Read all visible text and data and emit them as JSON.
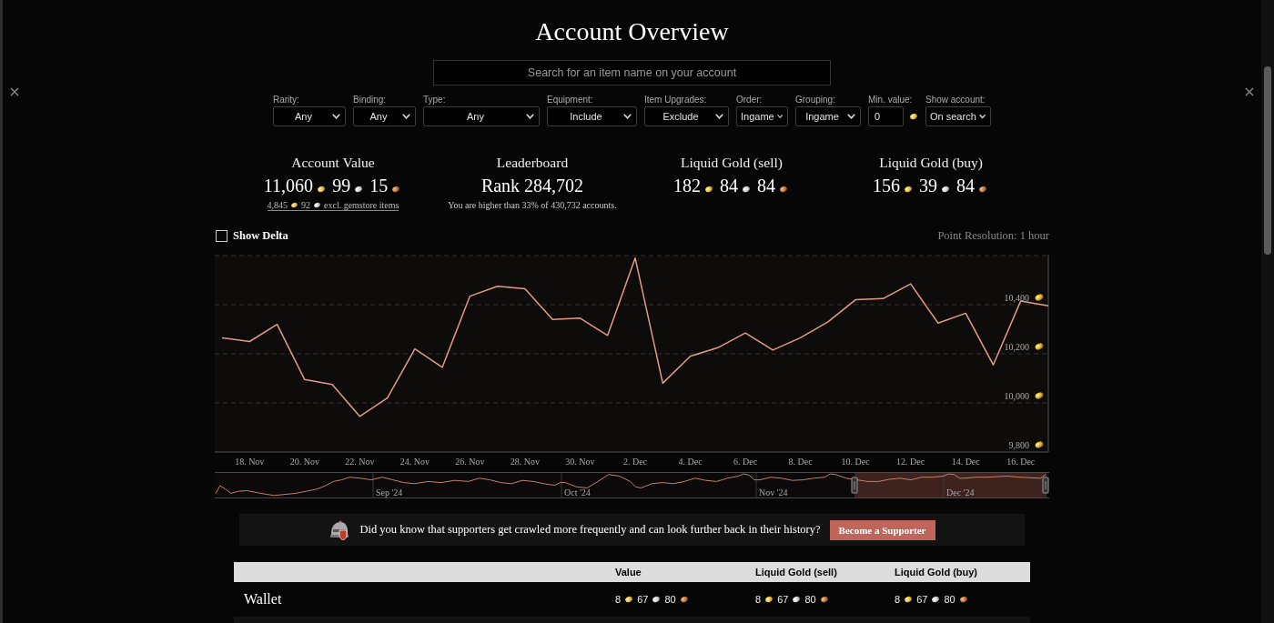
{
  "page": {
    "title": "Account Overview"
  },
  "search": {
    "placeholder": "Search for an item name on your account"
  },
  "filters": [
    {
      "label": "Rarity:",
      "value": "Any",
      "kind": "select"
    },
    {
      "label": "Binding:",
      "value": "Any",
      "kind": "select"
    },
    {
      "label": "Type:",
      "value": "Any",
      "kind": "select"
    },
    {
      "label": "Equipment:",
      "value": "Include",
      "kind": "select"
    },
    {
      "label": "Item Upgrades:",
      "value": "Exclude",
      "kind": "select"
    },
    {
      "label": "Order:",
      "value": "Ingame",
      "kind": "select"
    },
    {
      "label": "Grouping:",
      "value": "Ingame",
      "kind": "select"
    },
    {
      "label": "Min. value:",
      "value": "0",
      "kind": "gold"
    },
    {
      "label": "Show account:",
      "value": "On search",
      "kind": "select"
    }
  ],
  "stats": [
    {
      "kind": "coins",
      "title": "Account Value",
      "value": {
        "gold": "11,060",
        "silver": "99",
        "copper": "15"
      },
      "note": {
        "gold": "4,845",
        "silver": "92",
        "text": "excl. gemstore items"
      }
    },
    {
      "kind": "rank",
      "title": "Leaderboard",
      "value": "Rank 284,702",
      "note": "You are higher than 33% of 430,732 accounts."
    },
    {
      "kind": "coins",
      "title": "Liquid Gold (sell)",
      "value": {
        "gold": "182",
        "silver": "84",
        "copper": "84"
      }
    },
    {
      "kind": "coins",
      "title": "Liquid Gold (buy)",
      "value": {
        "gold": "156",
        "silver": "39",
        "copper": "84"
      }
    }
  ],
  "chart": {
    "show_delta": {
      "label": "Show Delta",
      "checked": false
    },
    "resolution": "Point Resolution: 1 hour",
    "chart_data": {
      "type": "line",
      "grid": true,
      "categories": [
        null,
        "18. Nov",
        null,
        "20. Nov",
        null,
        "22. Nov",
        null,
        "24. Nov",
        null,
        "26. Nov",
        null,
        "28. Nov",
        null,
        "30. Nov",
        null,
        "2. Dec",
        null,
        "4. Dec",
        null,
        "6. Dec",
        null,
        "8. Dec",
        null,
        "10. Dec",
        null,
        "12. Dec",
        null,
        "14. Dec",
        null,
        "16. Dec",
        null
      ],
      "series": [
        {
          "color": "#e39b86",
          "values": [
            10265,
            10250,
            10320,
            10095,
            10075,
            9945,
            10020,
            10220,
            10145,
            10435,
            10475,
            10465,
            10340,
            10345,
            10275,
            10590,
            10080,
            10190,
            10225,
            10285,
            10215,
            10265,
            10330,
            10420,
            10425,
            10485,
            10325,
            10365,
            10155,
            10415,
            10395
          ]
        }
      ],
      "ylim": [
        9800,
        10600
      ],
      "yticks": [
        {
          "value": 9800,
          "label": "9,800"
        },
        {
          "value": 10000,
          "label": "10,000"
        },
        {
          "value": 10200,
          "label": "10,200"
        },
        {
          "value": 10400,
          "label": "10,400"
        }
      ]
    }
  },
  "navigator": {
    "labels": [
      "Sep '24",
      "Oct '24",
      "Nov '24",
      "Dec '24"
    ]
  },
  "banner": {
    "text": "Did you know that supporters get crawled more frequently and can look further back in their history?",
    "button": "Become a Supporter"
  },
  "table": {
    "columns": [
      "Value",
      "Liquid Gold (sell)",
      "Liquid Gold (buy)"
    ],
    "rows": [
      {
        "name": "Wallet",
        "cells": [
          {
            "gold": "8",
            "silver": "67",
            "copper": "80"
          },
          {
            "gold": "8",
            "silver": "67",
            "copper": "80"
          },
          {
            "gold": "8",
            "silver": "67",
            "copper": "80"
          }
        ]
      }
    ]
  }
}
